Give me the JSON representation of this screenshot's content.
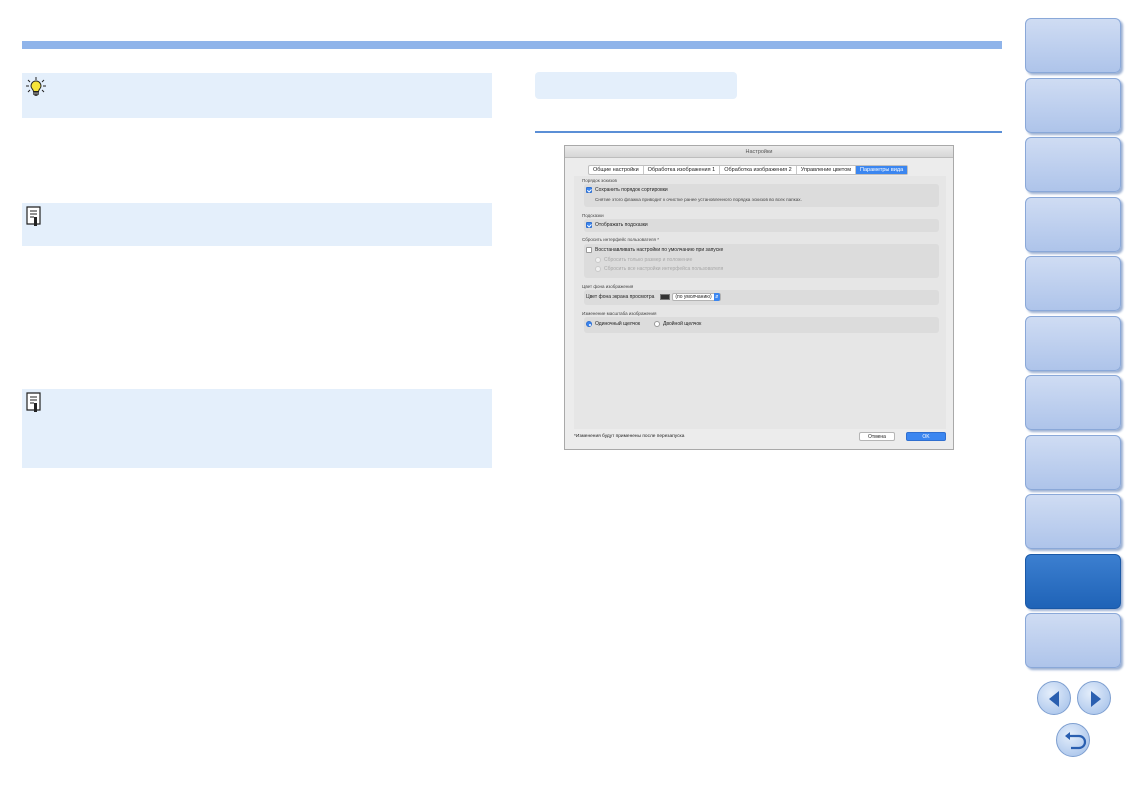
{
  "dialog": {
    "title": "Настройки",
    "tabs": [
      "Общие настройки",
      "Обработка изображения 1",
      "Обработка изображения 2",
      "Управление цветом",
      "Параметры вида"
    ],
    "active_tab": 4,
    "sections": {
      "thumbnail_order": {
        "heading": "Порядок эскизов",
        "checkbox_label": "Сохранить порядок сортировки",
        "checked": true,
        "description": "Снятие этого флажка приводит к очистке ранее установленного порядка эскизов во всех папках."
      },
      "tooltips": {
        "heading": "Подсказки",
        "checkbox_label": "Отображать подсказки",
        "checked": true
      },
      "reset_ui": {
        "heading": "Сбросить интерфейс пользователя *",
        "checkbox_label": "Восстанавливать настройки по умолчанию при запуске",
        "checked": false,
        "option1": "Сбросить только размер и положение",
        "option2": "Сбросить все настройки интерфейса пользователя"
      },
      "bg_color": {
        "heading": "Цвет фона изображения",
        "label": "Цвет фона экрана просмотра",
        "value": "(по умолчанию)",
        "swatch_color": "#333333"
      },
      "zoom": {
        "heading": "Изменение масштаба изображения",
        "option1": "Одиночный щелчок",
        "option2": "Двойной щелчок",
        "selected": 0
      }
    },
    "footer_note": "*Изменения будут применены после перезапуска",
    "cancel_label": "Отмена",
    "ok_label": "OK"
  },
  "colors": {
    "accent": "#3b86f0",
    "top_bar": "#8fb4ea",
    "note_bg": "#e4effb",
    "nav_active": "#1f63b7"
  },
  "nav": {
    "tab_count": 11,
    "active_index": 9,
    "prev_icon": "arrow-left-icon",
    "next_icon": "arrow-right-icon",
    "return_icon": "return-icon"
  }
}
